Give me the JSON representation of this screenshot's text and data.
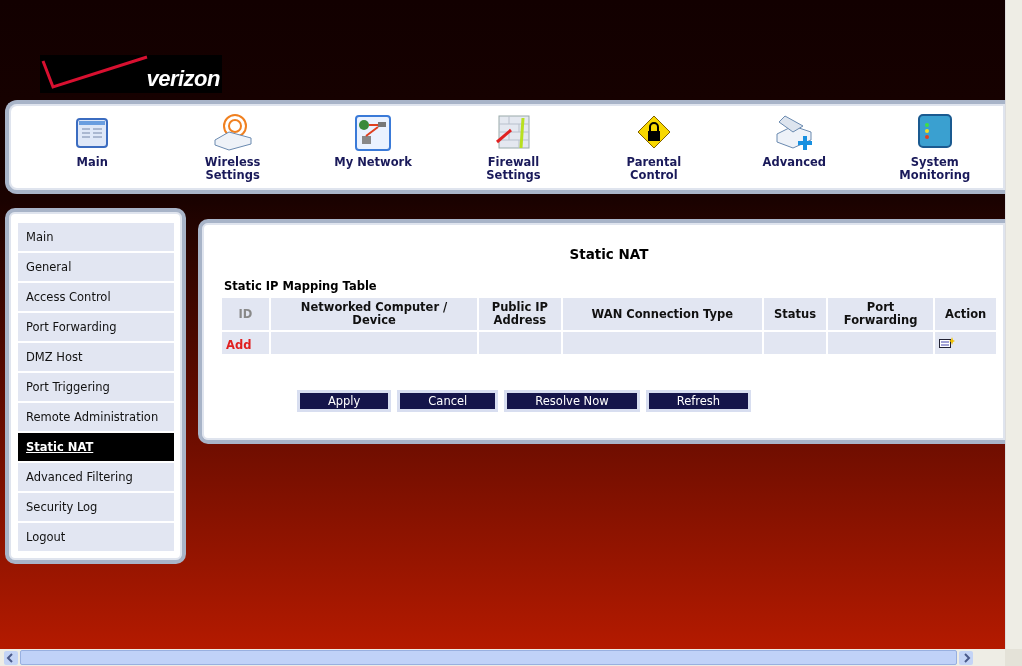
{
  "logo": {
    "text": "verizon"
  },
  "nav": [
    {
      "label": "Main",
      "kind": "main"
    },
    {
      "label": "Wireless\nSettings",
      "kind": "wireless"
    },
    {
      "label": "My Network",
      "kind": "network"
    },
    {
      "label": "Firewall\nSettings",
      "kind": "firewall"
    },
    {
      "label": "Parental\nControl",
      "kind": "parental"
    },
    {
      "label": "Advanced",
      "kind": "advanced"
    },
    {
      "label": "System\nMonitoring",
      "kind": "monitoring"
    }
  ],
  "sidebar": {
    "items": [
      {
        "label": "Main",
        "selected": false
      },
      {
        "label": "General",
        "selected": false
      },
      {
        "label": "Access Control",
        "selected": false
      },
      {
        "label": "Port Forwarding",
        "selected": false
      },
      {
        "label": "DMZ Host",
        "selected": false
      },
      {
        "label": "Port Triggering",
        "selected": false
      },
      {
        "label": "Remote Administration",
        "selected": false
      },
      {
        "label": "Static NAT",
        "selected": true
      },
      {
        "label": "Advanced Filtering",
        "selected": false
      },
      {
        "label": "Security Log",
        "selected": false
      },
      {
        "label": "Logout",
        "selected": false
      }
    ]
  },
  "content": {
    "title": "Static NAT",
    "table_title": "Static IP Mapping Table",
    "table": {
      "columns": [
        {
          "label": "ID",
          "disabled": true
        },
        {
          "label": "Networked Computer /\nDevice",
          "disabled": false
        },
        {
          "label": "Public IP\nAddress",
          "disabled": false
        },
        {
          "label": "WAN Connection Type",
          "disabled": false
        },
        {
          "label": "Status",
          "disabled": false
        },
        {
          "label": "Port\nForwarding",
          "disabled": false
        },
        {
          "label": "Action",
          "disabled": false
        }
      ],
      "add_link": "Add"
    },
    "buttons": [
      "Apply",
      "Cancel",
      "Resolve Now",
      "Refresh"
    ]
  }
}
